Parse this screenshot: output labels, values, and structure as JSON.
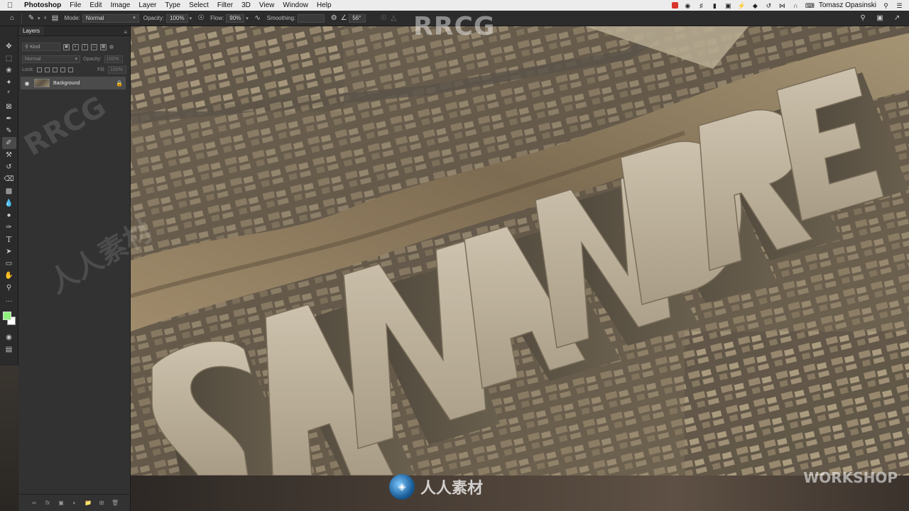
{
  "menubar": {
    "app_name": "Photoshop",
    "menus": [
      "File",
      "Edit",
      "Image",
      "Layer",
      "Type",
      "Select",
      "Filter",
      "3D",
      "View",
      "Window",
      "Help"
    ],
    "user": "Tomasz Opasinski"
  },
  "options_bar": {
    "mode_label": "Mode:",
    "mode_value": "Normal",
    "opacity_label": "Opacity:",
    "opacity_value": "100%",
    "flow_label": "Flow:",
    "flow_value": "90%",
    "smoothing_label": "Smoothing:",
    "smoothing_value": "",
    "angle_value": "56°",
    "brush_size": "4"
  },
  "layers_panel": {
    "tab_label": "Layers",
    "filter_kind": "Kind",
    "blend_mode": "Normal",
    "opacity_label": "Opacity:",
    "opacity_value": "100%",
    "lock_label": "Lock:",
    "fill_label": "Fill:",
    "fill_value": "100%",
    "layers": [
      {
        "name": "Background",
        "visible": true,
        "locked": true
      }
    ]
  },
  "toolbar": {
    "tools": [
      "move-tool",
      "marquee-tool",
      "lasso-tool",
      "magic-wand-tool",
      "crop-tool",
      "frame-tool",
      "eyedropper-tool",
      "healing-brush-tool",
      "brush-tool",
      "clone-stamp-tool",
      "history-brush-tool",
      "eraser-tool",
      "gradient-tool",
      "blur-tool",
      "dodge-tool",
      "pen-tool",
      "type-tool",
      "path-selection-tool",
      "rectangle-tool",
      "hand-tool",
      "zoom-tool",
      "more-tools"
    ],
    "active_tool": "brush-tool",
    "foreground_color": "#8ef07a",
    "background_color": "#ffffff"
  },
  "canvas": {
    "headline_text": "SAN ANDREAS"
  },
  "watermarks": {
    "top": "RRCG",
    "side": "RRCG",
    "side_cjk": "人人素材",
    "bottom_cjk": "人人素材",
    "right_line1": "WORKSHOP"
  }
}
